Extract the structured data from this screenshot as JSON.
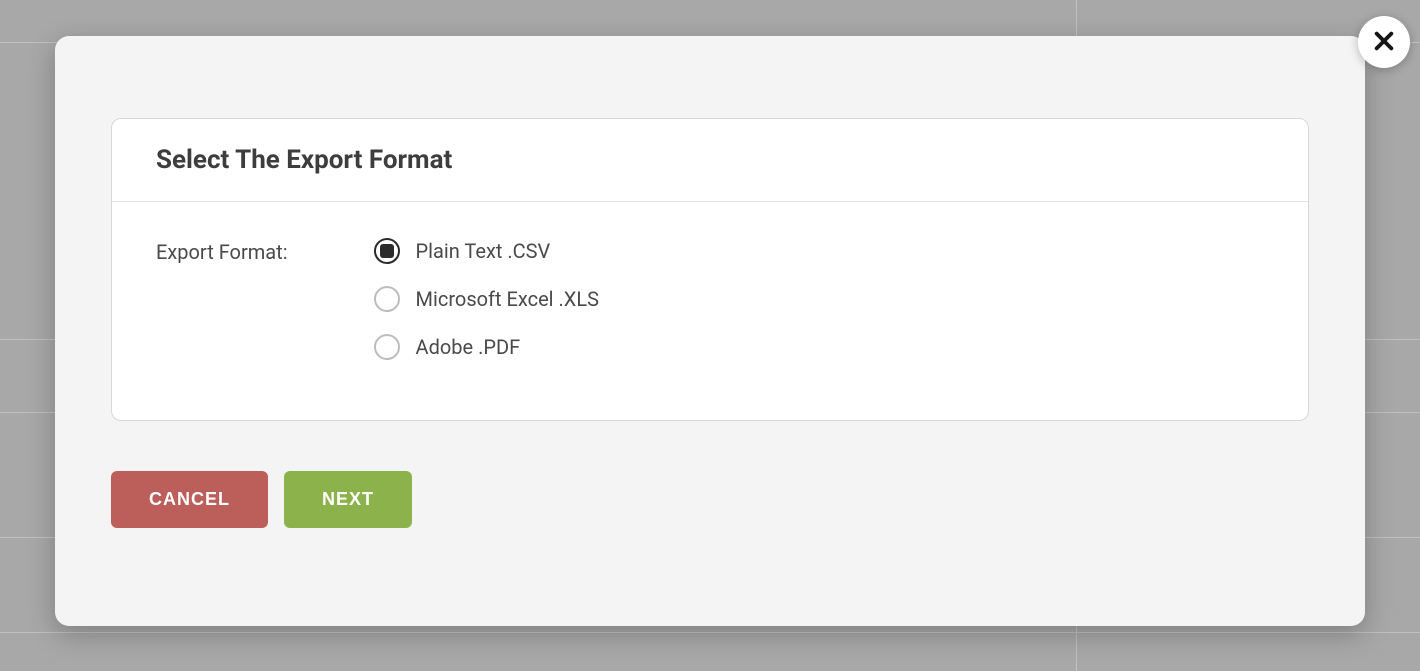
{
  "modal": {
    "title": "Select The Export Format",
    "fieldLabel": "Export Format:",
    "options": [
      {
        "label": "Plain Text .CSV",
        "checked": true
      },
      {
        "label": "Microsoft Excel .XLS",
        "checked": false
      },
      {
        "label": "Adobe .PDF",
        "checked": false
      }
    ],
    "buttons": {
      "cancel": "CANCEL",
      "next": "NEXT"
    }
  }
}
